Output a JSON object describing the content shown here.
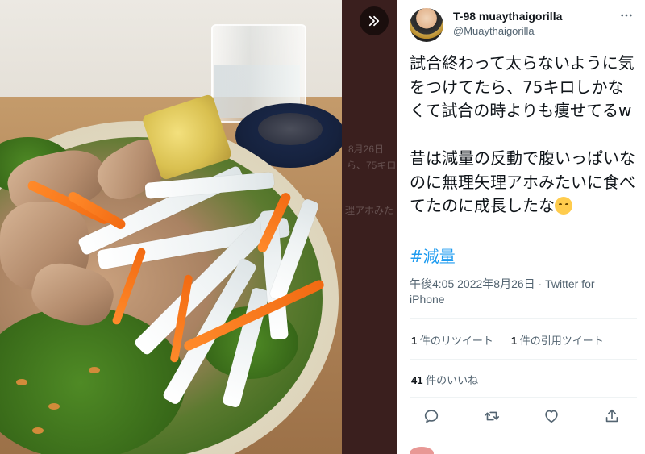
{
  "photo": {
    "alt_overlay_lines": [
      "8月26日",
      "ら、75キロ",
      "理アホみた"
    ]
  },
  "tweet": {
    "author_name": "T-98 muaythaigorilla",
    "author_handle": "@Muaythaigorilla",
    "text": "試合終わって太らないように気をつけてたら、75キロしかなくて試合の時よりも痩せてるw\n\n昔は減量の反動で腹いっぱいなのに無理矢理アホみたいに食べてたのに成長したな",
    "emoji": "relieved-face",
    "hashtag": "#減量",
    "time": "午後4:05",
    "date": "2022年8月26日",
    "separator": "·",
    "source": "Twitter for iPhone",
    "retweets": {
      "count": "1",
      "label": "件のリツイート"
    },
    "quotes": {
      "count": "1",
      "label": "件の引用ツイート"
    },
    "likes": {
      "count": "41",
      "label": "件のいいね"
    }
  },
  "colors": {
    "link": "#1d9bf0",
    "text": "#0f1419",
    "muted": "#536471",
    "divider": "#eff3f4"
  },
  "icons": {
    "expand": "double-chevron-right-icon",
    "more": "more-horizontal-icon",
    "reply": "reply-icon",
    "retweet": "retweet-icon",
    "like": "heart-icon",
    "share": "share-icon"
  }
}
